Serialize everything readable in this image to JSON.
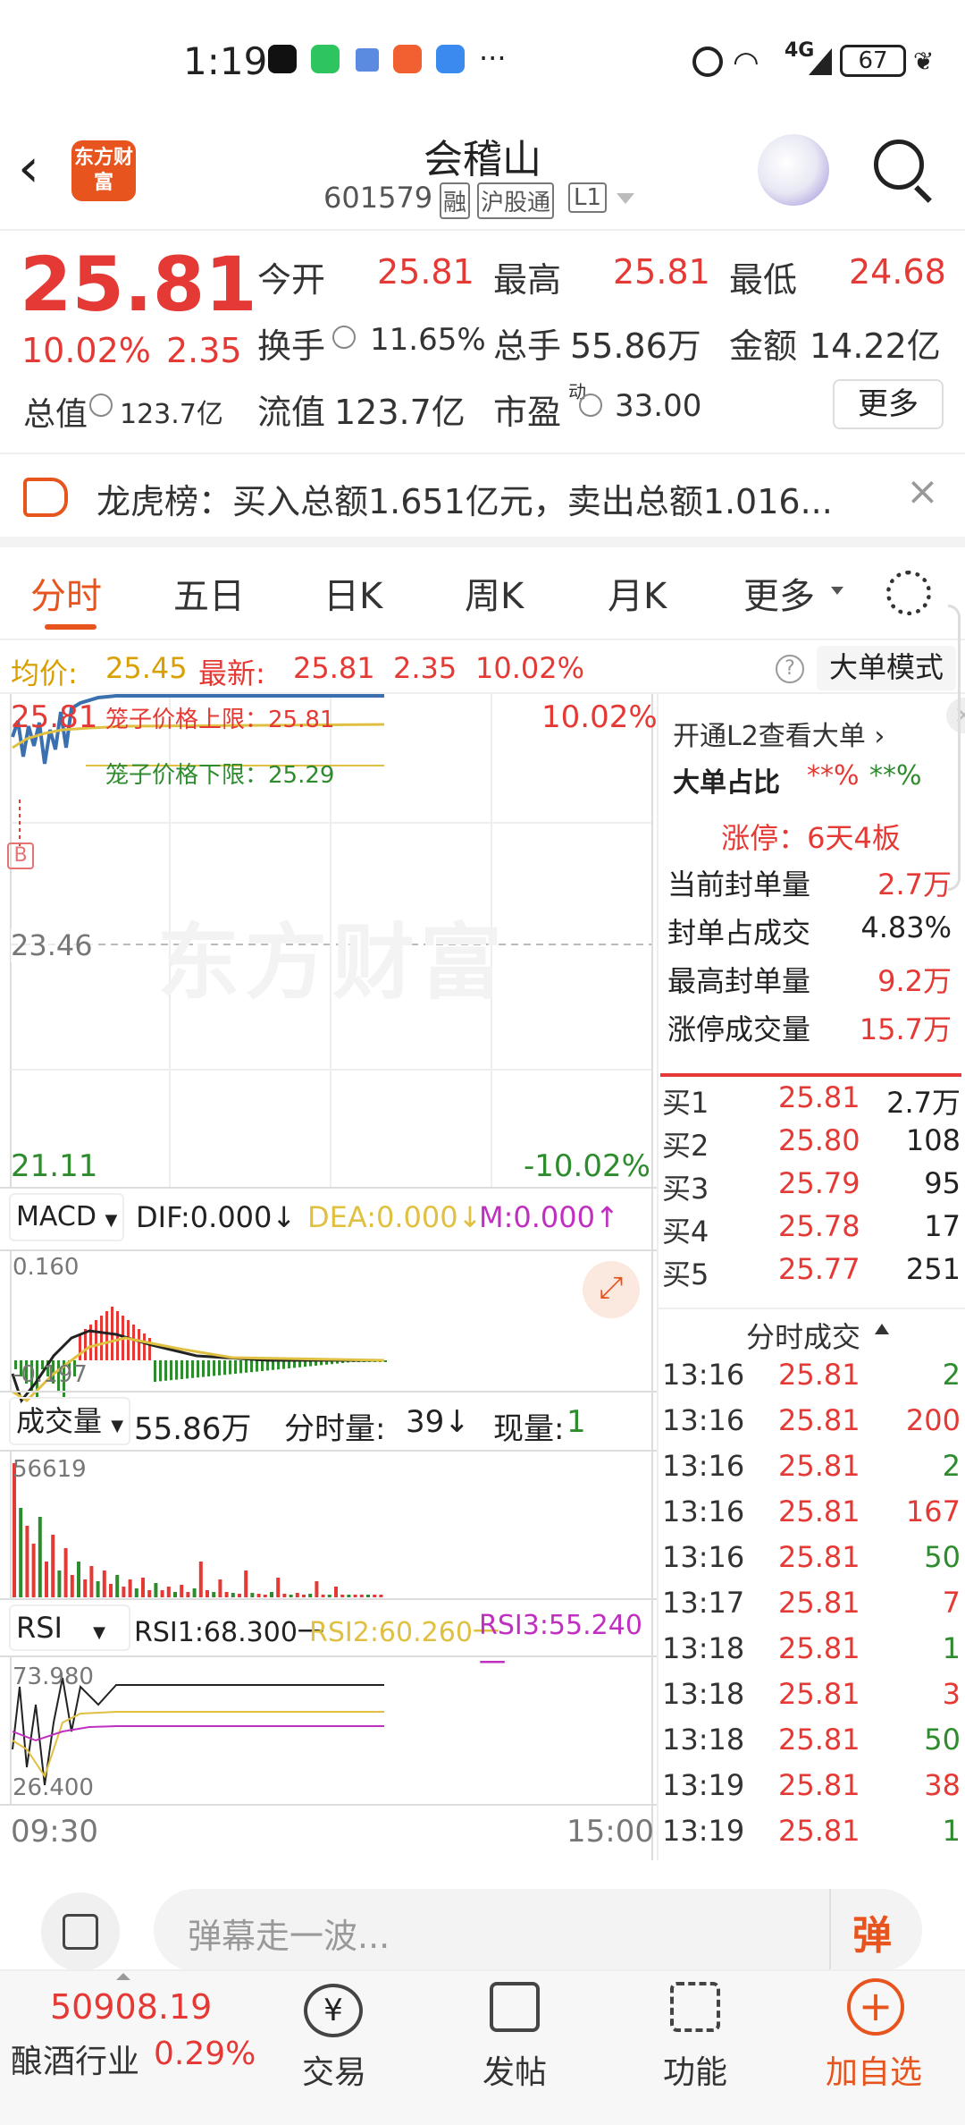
{
  "status": {
    "time": "1:19",
    "signal": "4G",
    "battery": "67"
  },
  "header": {
    "title": "会稽山",
    "code": "601579",
    "tags": [
      "融",
      "沪股通",
      "L1"
    ],
    "logo_text": "东方财富"
  },
  "quote": {
    "price": "25.81",
    "change_pct": "10.02%",
    "change": "2.35",
    "open_label": "今开",
    "open": "25.81",
    "high_label": "最高",
    "high": "25.81",
    "low_label": "最低",
    "low": "24.68",
    "turnover_label": "换手",
    "turnover": "11.65%",
    "volume_label": "总手",
    "volume": "55.86万",
    "amount_label": "金额",
    "amount": "14.22亿",
    "mktcap_label": "总值",
    "mktcap": "123.7亿",
    "float_label": "流值",
    "float": "123.7亿",
    "pe_label": "市盈",
    "pe_sup": "动",
    "pe": "33.00",
    "more_label": "更多"
  },
  "notice": {
    "text": "龙虎榜：买入总额1.651亿元，卖出总额1.016..."
  },
  "tabs": [
    "分时",
    "五日",
    "日K",
    "周K",
    "月K",
    "更多"
  ],
  "avgbar": {
    "avg_label": "均价:",
    "avg": "25.45",
    "latest_label": "最新:",
    "latest": "25.81",
    "chg": "2.35",
    "pct": "10.02%",
    "mode_label": "大单模式"
  },
  "chart": {
    "ytop": "25.81",
    "ytop_pct": "10.02%",
    "ymid": "23.46",
    "ybot": "21.11",
    "ybot_pct": "-10.02%",
    "upper_label": "笼子价格上限：25.81",
    "lower_label": "笼子价格下限：25.29",
    "b_marker": "B",
    "watermark": "东方财富",
    "macd_sel": "MACD",
    "dif": "DIF:0.000↓",
    "dea": "DEA:0.000↓",
    "m": "M:0.000↑",
    "macd_top": "0.160",
    "macd_bot": "-0.197",
    "vol_sel": "成交量",
    "vol_total": "55.86万",
    "vol_min_label": "分时量:",
    "vol_min": "39↓",
    "vol_now_label": "现量:",
    "vol_now": "1",
    "vol_max": "56619",
    "rsi_sel": "RSI",
    "rsi1": "RSI1:68.300一",
    "rsi2": "RSI2:60.260一",
    "rsi3": "RSI3:55.240一",
    "rsi_top": "73.980",
    "rsi_bot": "26.400",
    "t_start": "09:30",
    "t_end": "15:00",
    "colors": {
      "up": "#e53935",
      "down": "#2e8b2e",
      "price": "#3a6fb0",
      "avg": "#e0c040",
      "rsi3": "#c030c0"
    }
  },
  "side": {
    "l2_link": "开通L2查看大单",
    "big_label": "大单占比",
    "big_red": "**%",
    "big_green": "**%",
    "limit_title": "涨停：6天4板",
    "stats": [
      {
        "label": "当前封单量",
        "value": "2.7万"
      },
      {
        "label": "封单占成交",
        "value": "4.83%"
      },
      {
        "label": "最高封单量",
        "value": "9.2万"
      },
      {
        "label": "涨停成交量",
        "value": "15.7万"
      }
    ],
    "bids": [
      {
        "label": "买1",
        "price": "25.81",
        "qty": "2.7万"
      },
      {
        "label": "买2",
        "price": "25.80",
        "qty": "108"
      },
      {
        "label": "买3",
        "price": "25.79",
        "qty": "95"
      },
      {
        "label": "买4",
        "price": "25.78",
        "qty": "17"
      },
      {
        "label": "买5",
        "price": "25.77",
        "qty": "251"
      }
    ],
    "ticks_title": "分时成交",
    "ticks": [
      {
        "t": "13:16",
        "p": "25.81",
        "q": "2"
      },
      {
        "t": "13:16",
        "p": "25.81",
        "q": "200"
      },
      {
        "t": "13:16",
        "p": "25.81",
        "q": "2"
      },
      {
        "t": "13:16",
        "p": "25.81",
        "q": "167"
      },
      {
        "t": "13:16",
        "p": "25.81",
        "q": "50"
      },
      {
        "t": "13:17",
        "p": "25.81",
        "q": "7"
      },
      {
        "t": "13:18",
        "p": "25.81",
        "q": "1"
      },
      {
        "t": "13:18",
        "p": "25.81",
        "q": "3"
      },
      {
        "t": "13:18",
        "p": "25.81",
        "q": "50"
      },
      {
        "t": "13:19",
        "p": "25.81",
        "q": "38"
      },
      {
        "t": "13:19",
        "p": "25.81",
        "q": "1"
      }
    ]
  },
  "bottom": {
    "danmu_placeholder": "弹幕走一波...",
    "danmu_btn": "弹",
    "index_value": "50908.19",
    "index_name": "酿酒行业",
    "index_pct": "0.29%",
    "nav": [
      {
        "label": "交易"
      },
      {
        "label": "发帖"
      },
      {
        "label": "功能"
      },
      {
        "label": "加自选"
      }
    ]
  }
}
